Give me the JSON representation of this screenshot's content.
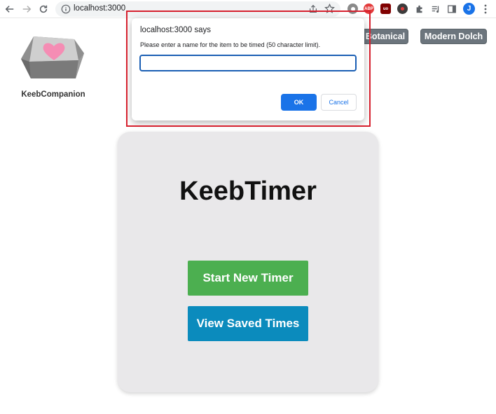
{
  "browser": {
    "url": "localhost:3000",
    "profile_initial": "J",
    "extensions": [
      {
        "name": "adblock-plus-icon",
        "label": "ABP",
        "color": "#e33b3b"
      },
      {
        "name": "ublock-icon",
        "label": "uo",
        "color": "#800000"
      }
    ]
  },
  "header": {
    "brand": "KeebCompanion",
    "themes": [
      "Botanical",
      "Modern Dolch"
    ]
  },
  "main": {
    "title": "KeebTimer",
    "start_button": "Start New Timer",
    "view_button": "View Saved Times"
  },
  "dialog": {
    "title": "localhost:3000 says",
    "message": "Please enter a name for the item to be timed (50 character limit).",
    "input_value": "",
    "ok_label": "OK",
    "cancel_label": "Cancel"
  },
  "colors": {
    "start": "#4caf50",
    "view": "#0b8bbd",
    "card": "#e9e8ea",
    "highlight": "#d6202e",
    "accent": "#1a73e8"
  }
}
